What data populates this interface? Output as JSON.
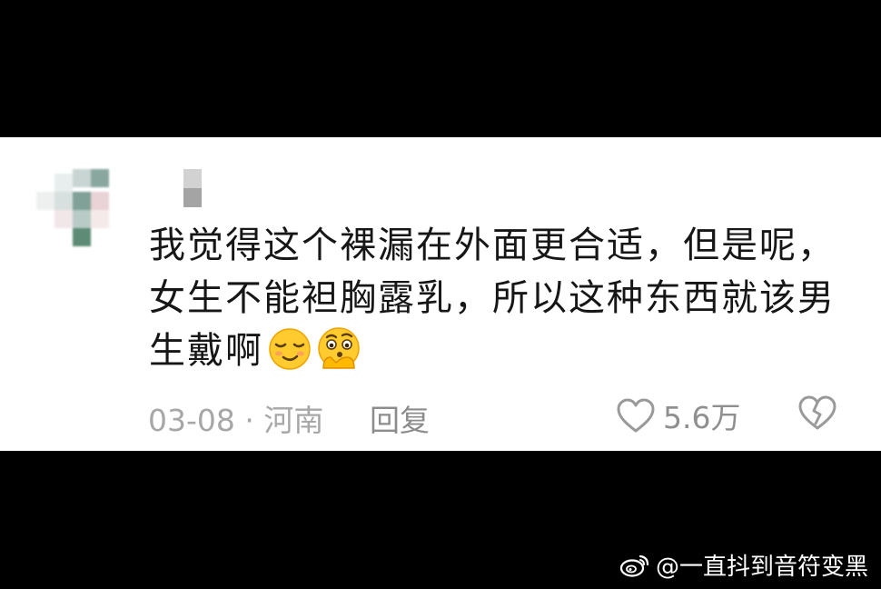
{
  "comment": {
    "lines": [
      "我觉得这个裸漏在外面更合适，但是呢，",
      "女生不能袒胸露乳，所以这种东西就该男",
      "生戴啊"
    ],
    "emojis": [
      "smirk-emoji",
      "thinking-emoji"
    ]
  },
  "meta": {
    "date": "03-08",
    "separator": "·",
    "location": "河南",
    "reply_label": "回复",
    "like_count": "5.6万"
  },
  "watermark": {
    "text": "@一直抖到音符变黑",
    "icon": "weibo-icon"
  },
  "colors": {
    "background": "#000000",
    "card": "#ffffff",
    "text": "#161616",
    "meta": "#a7a7a7",
    "watermark": "#ffffff"
  }
}
